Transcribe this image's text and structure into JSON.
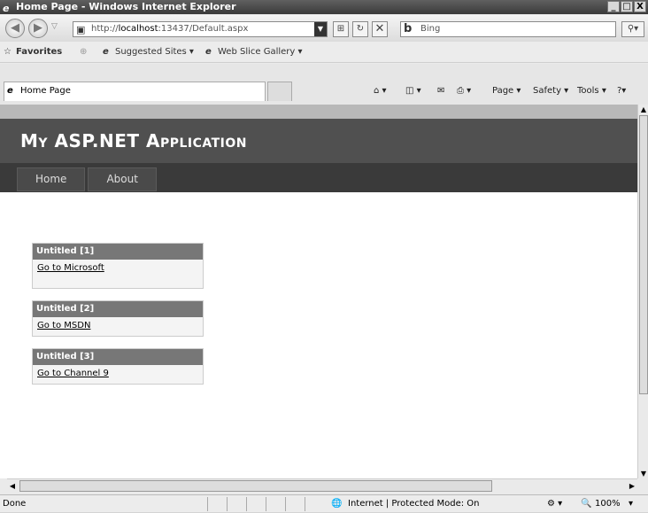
{
  "window": {
    "title": "Home Page - Windows Internet Explorer",
    "min": "_",
    "max": "□",
    "close": "X"
  },
  "navbar": {
    "address_prefix": "http://",
    "address_host": "localhost",
    "address_rest": ":13437/Default.aspx",
    "search_placeholder": "Bing"
  },
  "favorites": {
    "favorites_label": "Favorites",
    "suggested_label": "Suggested Sites ▾",
    "webslice_label": "Web Slice Gallery ▾"
  },
  "tabs": {
    "active_tab": "Home Page"
  },
  "commandbar": {
    "page": "Page ▾",
    "safety": "Safety ▾",
    "tools": "Tools ▾",
    "help": "?▾"
  },
  "page": {
    "site_title": "My ASP.NET Application",
    "menu": [
      "Home",
      "About"
    ],
    "widgets": [
      {
        "title": "Untitled [1]",
        "link": "Go to Microsoft"
      },
      {
        "title": "Untitled [2]",
        "link": "Go to MSDN"
      },
      {
        "title": "Untitled [3]",
        "link": "Go to Channel 9"
      }
    ]
  },
  "status": {
    "left": "Done",
    "zone": "Internet | Protected Mode: On",
    "zoom": "100%"
  }
}
